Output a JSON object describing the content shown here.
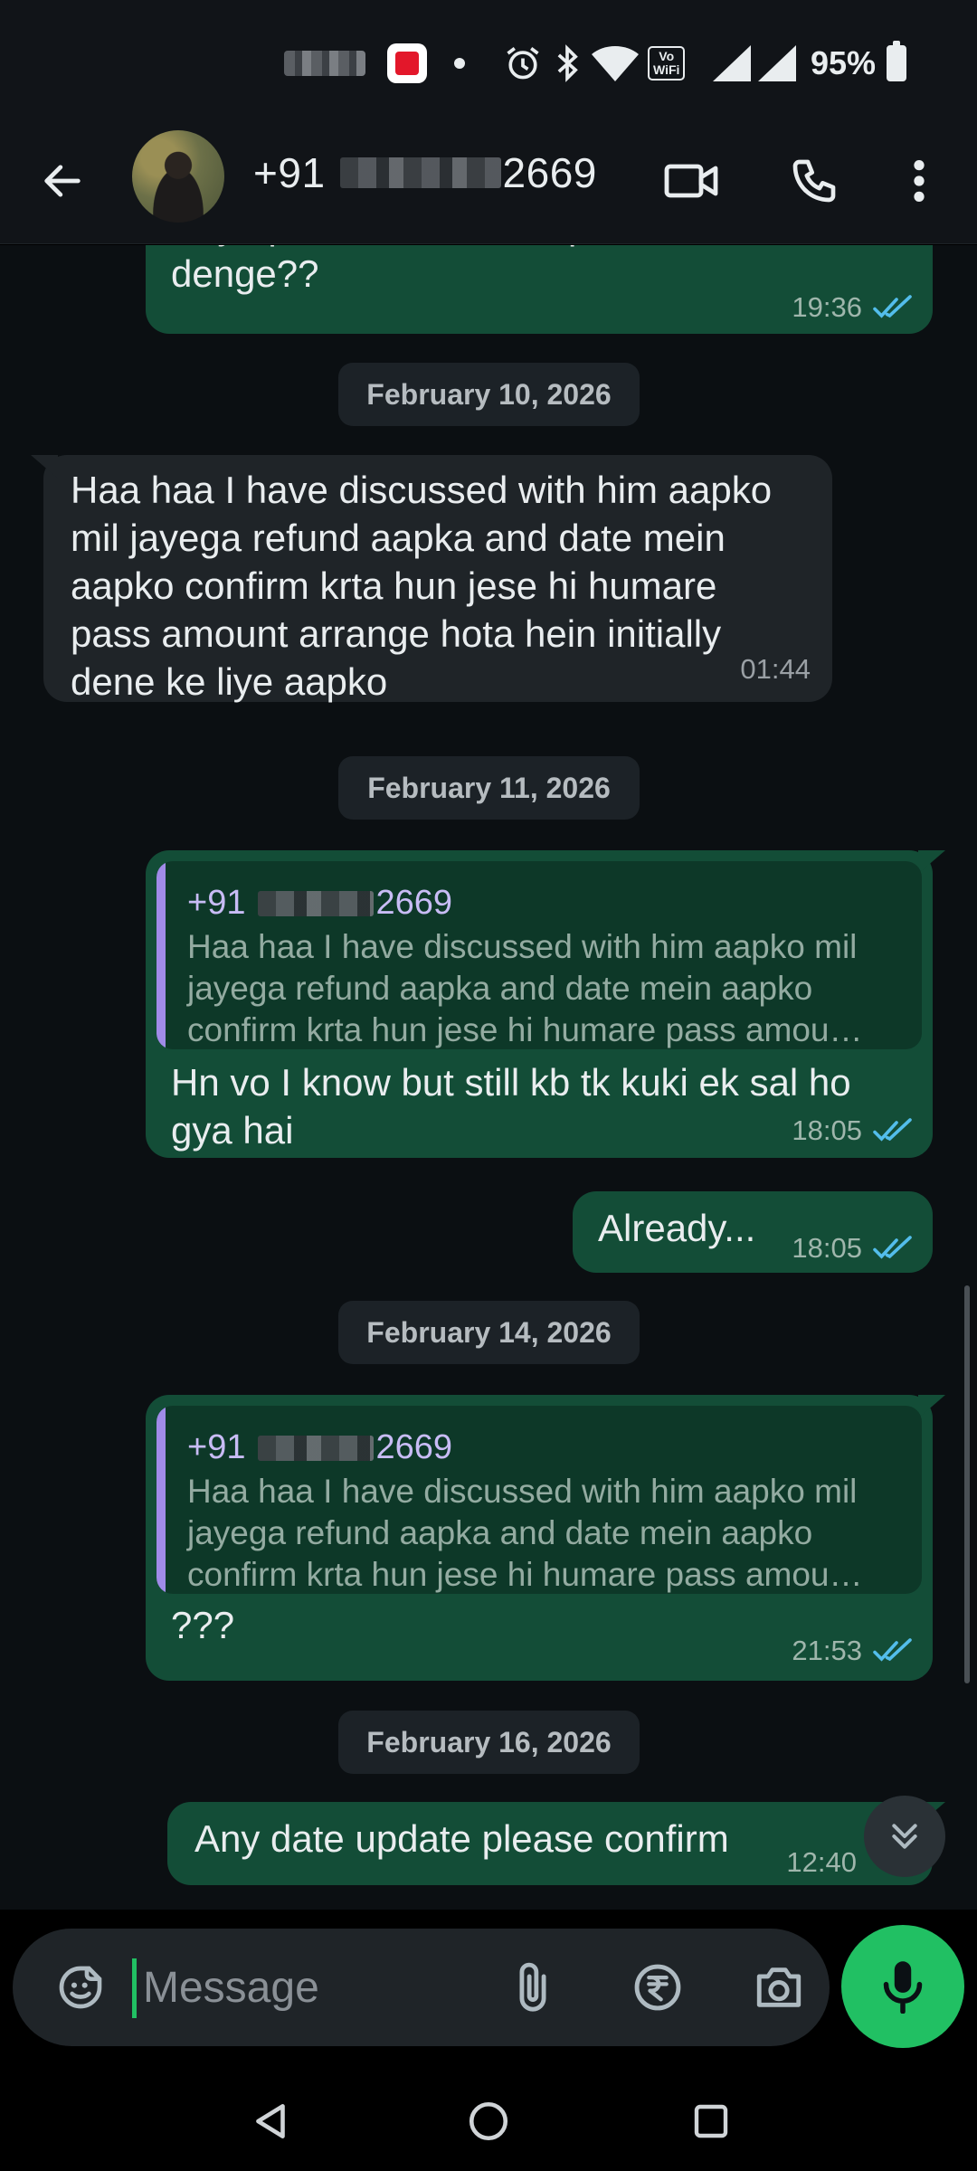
{
  "status_bar": {
    "battery": "95%",
    "network_badge": [
      "Vo",
      "WiFi"
    ],
    "icons": [
      "shopping-app-icon",
      "dot-icon",
      "alarm-icon",
      "bluetooth-icon",
      "wifi-icon",
      "signal-icon",
      "battery-icon"
    ]
  },
  "header": {
    "contact_prefix": "+91",
    "contact_suffix": "2669",
    "icons": [
      "back-arrow-icon",
      "video-call-icon",
      "voice-call-icon",
      "more-options-icon"
    ]
  },
  "chat": {
    "messages": [
      {
        "type": "out",
        "text": "Any update bhai kb tk ap first installment denge??",
        "time": "19:36",
        "read": true
      },
      {
        "type": "date",
        "text": "February 10, 2026"
      },
      {
        "type": "in",
        "text": "Haa haa I have discussed with him aapko mil jayega refund aapka and date mein aapko confirm krta hun jese hi humare pass amount arrange hota hein initially dene ke liye aapko",
        "time": "01:44"
      },
      {
        "type": "date",
        "text": "February 11, 2026"
      },
      {
        "type": "out",
        "quote_sender_prefix": "+91",
        "quote_sender_suffix": "2669",
        "quote_text": "Haa haa I have discussed with him aapko mil jayega refund aapka and date mein aapko confirm krta hun jese hi humare pass amou…",
        "text": "Hn vo I know but still kb tk kuki ek sal ho gya hai",
        "time": "18:05",
        "read": true
      },
      {
        "type": "out",
        "text": "Already...",
        "time": "18:05",
        "read": true
      },
      {
        "type": "date",
        "text": "February 14, 2026"
      },
      {
        "type": "out",
        "quote_sender_prefix": "+91",
        "quote_sender_suffix": "2669",
        "quote_text": "Haa haa I have discussed with him aapko mil jayega refund aapka and date mein aapko confirm krta hun jese hi humare pass amou…",
        "text": "???",
        "time": "21:53",
        "read": true
      },
      {
        "type": "date",
        "text": "February 16, 2026"
      },
      {
        "type": "out",
        "text": "Any date update please confirm",
        "time": "12:40",
        "read": true
      }
    ]
  },
  "input": {
    "placeholder": "Message",
    "icons": [
      "sticker-icon",
      "attach-icon",
      "rupee-payment-icon",
      "camera-icon",
      "mic-icon"
    ]
  },
  "nav": {
    "icons": [
      "nav-back-icon",
      "nav-home-icon",
      "nav-recents-icon"
    ]
  },
  "colors": {
    "outgoing_bubble": "#134d37",
    "incoming_bubble": "#1f2428",
    "accent_green": "#21c063",
    "read_ticks": "#53bdeb",
    "quote_bar": "#a08be8"
  }
}
